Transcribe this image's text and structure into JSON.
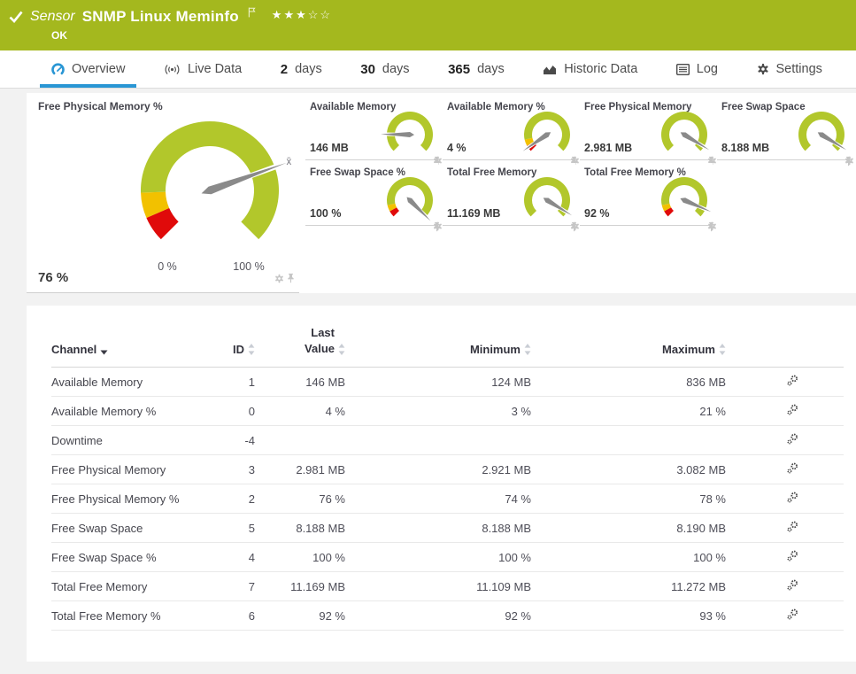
{
  "header": {
    "kind_label": "Sensor",
    "title": "SNMP Linux Meminfo",
    "status": "OK",
    "rating": {
      "filled": 3,
      "total": 5
    }
  },
  "tabs": [
    {
      "id": "overview",
      "icon": "gauge-icon",
      "label": "Overview",
      "active": true
    },
    {
      "id": "live-data",
      "icon": "broadcast-icon",
      "label": "Live Data"
    },
    {
      "id": "2-days",
      "strong": "2",
      "label": "days"
    },
    {
      "id": "30-days",
      "strong": "30",
      "label": "days"
    },
    {
      "id": "365-days",
      "strong": "365",
      "label": "days"
    },
    {
      "id": "historic-data",
      "icon": "area-chart-icon",
      "label": "Historic Data"
    },
    {
      "id": "log",
      "icon": "log-icon",
      "label": "Log"
    },
    {
      "id": "settings",
      "icon": "gear-icon",
      "label": "Settings"
    }
  ],
  "colors": {
    "header_bg": "#a4b81e",
    "accent_blue": "#2996d4",
    "gauge_green": "#b2c72b",
    "gauge_yellow": "#f2c100",
    "gauge_red": "#e00a0a",
    "needle": "#8a8a8a"
  },
  "main_gauge": {
    "title": "Free Physical Memory %",
    "value": "76 %",
    "min_label": "0 %",
    "max_label": "100 %",
    "avg_label": "x̄",
    "needle": 0.76,
    "avg": 0.76,
    "segments": [
      {
        "from": 0,
        "to": 0.08,
        "color": "red"
      },
      {
        "from": 0.08,
        "to": 0.16,
        "color": "yellow"
      },
      {
        "from": 0.16,
        "to": 1,
        "color": "green"
      }
    ]
  },
  "small_gauges": [
    {
      "title": "Available Memory",
      "value": "146 MB",
      "needle": 0.17,
      "segments": [
        {
          "from": 0,
          "to": 1,
          "color": "green"
        }
      ]
    },
    {
      "title": "Available Memory %",
      "value": "4 %",
      "needle": 0.04,
      "segments": [
        {
          "from": 0,
          "to": 0.06,
          "color": "red"
        },
        {
          "from": 0.06,
          "to": 0.12,
          "color": "yellow"
        },
        {
          "from": 0.12,
          "to": 1,
          "color": "green"
        }
      ]
    },
    {
      "title": "Free Physical Memory",
      "value": "2.981 MB",
      "needle": 0.95,
      "segments": [
        {
          "from": 0,
          "to": 1,
          "color": "green"
        }
      ]
    },
    {
      "title": "Free Swap Space",
      "value": "8.188 MB",
      "needle": 0.95,
      "segments": [
        {
          "from": 0,
          "to": 1,
          "color": "green"
        }
      ]
    },
    {
      "title": "Free Swap Space %",
      "value": "100 %",
      "needle": 1,
      "segments": [
        {
          "from": 0,
          "to": 0.06,
          "color": "red"
        },
        {
          "from": 0.06,
          "to": 0.12,
          "color": "yellow"
        },
        {
          "from": 0.12,
          "to": 1,
          "color": "green"
        }
      ]
    },
    {
      "title": "Total Free Memory",
      "value": "11.169 MB",
      "needle": 0.95,
      "segments": [
        {
          "from": 0,
          "to": 1,
          "color": "green"
        }
      ]
    },
    {
      "title": "Total Free Memory %",
      "value": "92 %",
      "needle": 0.92,
      "segments": [
        {
          "from": 0,
          "to": 0.06,
          "color": "red"
        },
        {
          "from": 0.06,
          "to": 0.12,
          "color": "yellow"
        },
        {
          "from": 0.12,
          "to": 1,
          "color": "green"
        }
      ]
    }
  ],
  "table": {
    "columns": [
      {
        "label": "Channel",
        "sort": "desc",
        "align": "left"
      },
      {
        "label": "ID",
        "sort": "both",
        "align": "right"
      },
      {
        "label": "Last Value",
        "sort": "both",
        "align": "right",
        "wrap": true
      },
      {
        "label": "Minimum",
        "sort": "both",
        "align": "right"
      },
      {
        "label": "Maximum",
        "sort": "both",
        "align": "right"
      },
      {
        "label": "",
        "align": "left"
      }
    ],
    "rows": [
      {
        "channel": "Available Memory",
        "id": "1",
        "last": "146 MB",
        "min": "124 MB",
        "max": "836 MB"
      },
      {
        "channel": "Available Memory %",
        "id": "0",
        "last": "4 %",
        "min": "3 %",
        "max": "21 %"
      },
      {
        "channel": "Downtime",
        "id": "-4",
        "last": "",
        "min": "",
        "max": ""
      },
      {
        "channel": "Free Physical Memory",
        "id": "3",
        "last": "2.981 MB",
        "min": "2.921 MB",
        "max": "3.082 MB"
      },
      {
        "channel": "Free Physical Memory %",
        "id": "2",
        "last": "76 %",
        "min": "74 %",
        "max": "78 %"
      },
      {
        "channel": "Free Swap Space",
        "id": "5",
        "last": "8.188 MB",
        "min": "8.188 MB",
        "max": "8.190 MB"
      },
      {
        "channel": "Free Swap Space %",
        "id": "4",
        "last": "100 %",
        "min": "100 %",
        "max": "100 %"
      },
      {
        "channel": "Total Free Memory",
        "id": "7",
        "last": "11.169 MB",
        "min": "11.109 MB",
        "max": "11.272 MB"
      },
      {
        "channel": "Total Free Memory %",
        "id": "6",
        "last": "92 %",
        "min": "92 %",
        "max": "93 %"
      }
    ]
  }
}
